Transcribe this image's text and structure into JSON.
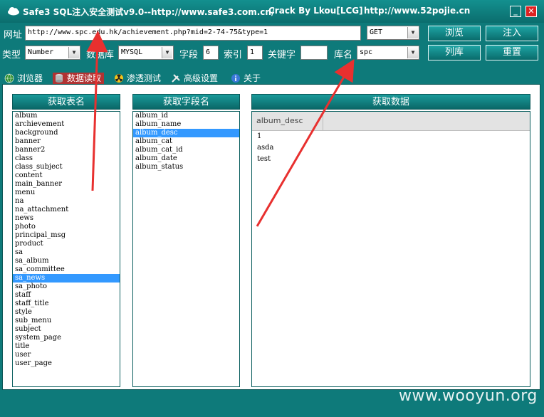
{
  "titlebar": {
    "app": "Safe3 SQL注入安全测试v9.0--http://www.safe3.com.cn/",
    "crack": "Crack  By  Lkou[LCG]",
    "url": "http://www.52pojie.cn",
    "min_label": "_",
    "close_label": "✕"
  },
  "form": {
    "url_label": "网址",
    "url_value": "http://www.spc.edu.hk/achievement.php?mid=2-74-75&type=1",
    "method_value": "GET",
    "type_label": "类型",
    "type_value": "Number",
    "db_label": "数据库",
    "db_value": "MYSQL",
    "field_label": "字段",
    "field_value": "6",
    "index_label": "索引",
    "index_value": "1",
    "keyword_label": "关键字",
    "keyword_value": "",
    "dbname_label": "库名",
    "dbname_value": "spc"
  },
  "buttons": {
    "browse": "浏览",
    "inject": "注入",
    "list_db": "列库",
    "reset": "重置"
  },
  "tabs": [
    {
      "label": "浏览器",
      "icon": "globe-icon"
    },
    {
      "label": "数据读取",
      "icon": "database-icon"
    },
    {
      "label": "渗透测试",
      "icon": "radiation-icon"
    },
    {
      "label": "高级设置",
      "icon": "tools-icon"
    },
    {
      "label": "关于",
      "icon": "info-icon"
    }
  ],
  "panels": {
    "tables_header": "获取表名",
    "fields_header": "获取字段名",
    "data_header": "获取数据"
  },
  "tables": [
    "album",
    "archievement",
    "background",
    "banner",
    "banner2",
    "class",
    "class_subject",
    "content",
    "main_banner",
    "menu",
    "na",
    "na_attachment",
    "news",
    "photo",
    "principal_msg",
    "product",
    "sa",
    "sa_album",
    "sa_committee",
    "sa_news",
    "sa_photo",
    "staff",
    "staff_title",
    "style",
    "sub_menu",
    "subject",
    "system_page",
    "title",
    "user",
    "user_page"
  ],
  "tables_selected": "sa_news",
  "fields": [
    "album_id",
    "album_name",
    "album_desc",
    "album_cat",
    "album_cat_id",
    "album_date",
    "album_status"
  ],
  "fields_selected": "album_desc",
  "data_grid": {
    "column": "album_desc",
    "rows": [
      "1",
      "asda",
      "test"
    ]
  },
  "watermark": "www.wooyun.org",
  "colors": {
    "accent": "#0e7a7a",
    "selection": "#3399ff",
    "annotation_arrow": "#e8302f"
  }
}
